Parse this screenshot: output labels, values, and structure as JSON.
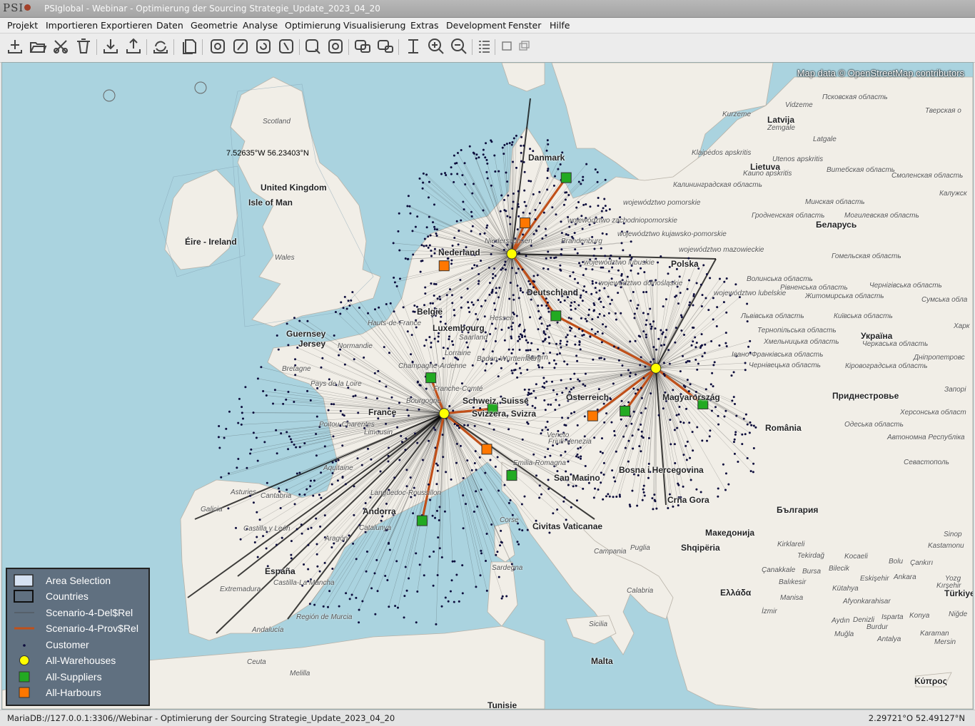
{
  "window": {
    "logo_text": "PSI",
    "title": "PSIglobal - Webinar - Optimierung der Sourcing Strategie_Update_2023_04_20"
  },
  "menu": [
    {
      "label": "Projekt"
    },
    {
      "label": "Importieren"
    },
    {
      "label": "Exportieren"
    },
    {
      "label": "Daten"
    },
    {
      "label": "Geometrie"
    },
    {
      "label": "Analyse"
    },
    {
      "label": "Optimierung"
    },
    {
      "label": "Visualisierung"
    },
    {
      "label": "Extras"
    },
    {
      "label": "Development"
    },
    {
      "label": "Fenster"
    },
    {
      "label": "Hilfe"
    }
  ],
  "toolbar": {
    "icons": [
      "new-icon",
      "open-icon",
      "close-icon",
      "delete-icon",
      "import-icon",
      "export-icon",
      "sync-icon",
      "layers-icon",
      "select-1-icon",
      "select-2-icon",
      "select-3-icon",
      "select-4-icon",
      "zoom-box-icon",
      "refresh-icon",
      "map-view-1-icon",
      "map-view-2-icon",
      "measure-icon",
      "zoom-in-icon",
      "zoom-out-icon",
      "list-icon",
      "window-icon",
      "windows-icon"
    ]
  },
  "map": {
    "attribution": "Map data © OpenStreetMap contributors",
    "cursor_coordinate": "7.52635°W 56.23403°N",
    "places": [
      {
        "name": "Scotland",
        "kind": "region"
      },
      {
        "name": "United Kingdom",
        "kind": "city"
      },
      {
        "name": "Isle of Man",
        "kind": "city"
      },
      {
        "name": "Éire - Ireland",
        "kind": "city"
      },
      {
        "name": "Wales",
        "kind": "region"
      },
      {
        "name": "Guernsey",
        "kind": "city"
      },
      {
        "name": "Jersey",
        "kind": "city"
      },
      {
        "name": "Bretagne",
        "kind": "region"
      },
      {
        "name": "Pays de la Loire",
        "kind": "region"
      },
      {
        "name": "France",
        "kind": "city"
      },
      {
        "name": "Poitou-Charentes",
        "kind": "region"
      },
      {
        "name": "Aquitaine",
        "kind": "region"
      },
      {
        "name": "Asturies",
        "kind": "region"
      },
      {
        "name": "Cantabria",
        "kind": "region"
      },
      {
        "name": "Galicia",
        "kind": "region"
      },
      {
        "name": "Castilla y León",
        "kind": "region"
      },
      {
        "name": "España",
        "kind": "city"
      },
      {
        "name": "Extremadura",
        "kind": "region"
      },
      {
        "name": "Castilla-La Mancha",
        "kind": "region"
      },
      {
        "name": "Andalucía",
        "kind": "region"
      },
      {
        "name": "Región de Murcia",
        "kind": "region"
      },
      {
        "name": "Ceuta",
        "kind": "region"
      },
      {
        "name": "Melilla",
        "kind": "region"
      },
      {
        "name": "Andorra",
        "kind": "city"
      },
      {
        "name": "Catalunya",
        "kind": "region"
      },
      {
        "name": "Aragón",
        "kind": "region"
      },
      {
        "name": "Bourgogne",
        "kind": "region"
      },
      {
        "name": "Lorraine",
        "kind": "region"
      },
      {
        "name": "Luxembourg",
        "kind": "city"
      },
      {
        "name": "België",
        "kind": "city"
      },
      {
        "name": "Nederland",
        "kind": "city"
      },
      {
        "name": "Danmark",
        "kind": "city"
      },
      {
        "name": "Deutschland",
        "kind": "city"
      },
      {
        "name": "Schweiz, Suisse",
        "kind": "city"
      },
      {
        "name": "Svizzera, Svizra",
        "kind": "city"
      },
      {
        "name": "Österreich",
        "kind": "city"
      },
      {
        "name": "Polska",
        "kind": "city"
      },
      {
        "name": "Magyarország",
        "kind": "city"
      },
      {
        "name": "România",
        "kind": "city"
      },
      {
        "name": "Bosna i Hercegovina",
        "kind": "city"
      },
      {
        "name": "Crna Gora",
        "kind": "city"
      },
      {
        "name": "San Marino",
        "kind": "city"
      },
      {
        "name": "Emilia-Romagna",
        "kind": "region"
      },
      {
        "name": "Corse",
        "kind": "region"
      },
      {
        "name": "Sardegna",
        "kind": "region"
      },
      {
        "name": "Civitas Vaticanae",
        "kind": "city"
      },
      {
        "name": "Campania",
        "kind": "region"
      },
      {
        "name": "Puglia",
        "kind": "region"
      },
      {
        "name": "Calabria",
        "kind": "region"
      },
      {
        "name": "Sicilia",
        "kind": "region"
      },
      {
        "name": "Malta",
        "kind": "city"
      },
      {
        "name": "Tunisie",
        "kind": "city"
      },
      {
        "name": "Shqipëria",
        "kind": "city"
      },
      {
        "name": "Македонија",
        "kind": "city"
      },
      {
        "name": "България",
        "kind": "city"
      },
      {
        "name": "Ελλάδα",
        "kind": "city"
      },
      {
        "name": "Türkiye",
        "kind": "city"
      },
      {
        "name": "Κύπρος",
        "kind": "city"
      },
      {
        "name": "Latvija",
        "kind": "city"
      },
      {
        "name": "Lietuva",
        "kind": "city"
      },
      {
        "name": "Беларусь",
        "kind": "city"
      },
      {
        "name": "Україна",
        "kind": "city"
      },
      {
        "name": "Приднестровье",
        "kind": "city"
      },
      {
        "name": "Kurzeme",
        "kind": "region"
      },
      {
        "name": "Zemgale",
        "kind": "region"
      },
      {
        "name": "Vidzeme",
        "kind": "region"
      },
      {
        "name": "Latgale",
        "kind": "region"
      },
      {
        "name": "Псковская область",
        "kind": "region"
      },
      {
        "name": "Тверская о",
        "kind": "region"
      },
      {
        "name": "Klaipėdos apskritis",
        "kind": "region"
      },
      {
        "name": "Utenos apskritis",
        "kind": "region"
      },
      {
        "name": "Kauno apskritis",
        "kind": "region"
      },
      {
        "name": "Витебская область",
        "kind": "region"
      },
      {
        "name": "Смоленская область",
        "kind": "region"
      },
      {
        "name": "Калининградская область",
        "kind": "region"
      },
      {
        "name": "Минская область",
        "kind": "region"
      },
      {
        "name": "Калужск",
        "kind": "region"
      },
      {
        "name": "Гродненская область",
        "kind": "region"
      },
      {
        "name": "Могилевская область",
        "kind": "region"
      },
      {
        "name": "Гомельская область",
        "kind": "region"
      },
      {
        "name": "województwo pomorskie",
        "kind": "region"
      },
      {
        "name": "województwo zachodniopomorskie",
        "kind": "region"
      },
      {
        "name": "województwo kujawsko-pomorskie",
        "kind": "region"
      },
      {
        "name": "województwo mazowieckie",
        "kind": "region"
      },
      {
        "name": "województwo lubuskie",
        "kind": "region"
      },
      {
        "name": "województwo dolnośląskie",
        "kind": "region"
      },
      {
        "name": "województwo lubelskie",
        "kind": "region"
      },
      {
        "name": "Волинська область",
        "kind": "region"
      },
      {
        "name": "Рівненська область",
        "kind": "region"
      },
      {
        "name": "Житомирська область",
        "kind": "region"
      },
      {
        "name": "Чернігівська область",
        "kind": "region"
      },
      {
        "name": "Сумська обла",
        "kind": "region"
      },
      {
        "name": "Львівська область",
        "kind": "region"
      },
      {
        "name": "Київська область",
        "kind": "region"
      },
      {
        "name": "Тернопільська область",
        "kind": "region"
      },
      {
        "name": "Хмельницька область",
        "kind": "region"
      },
      {
        "name": "Черкаська область",
        "kind": "region"
      },
      {
        "name": "Харк",
        "kind": "region"
      },
      {
        "name": "Івано-Франківська область",
        "kind": "region"
      },
      {
        "name": "Чернівецька область",
        "kind": "region"
      },
      {
        "name": "Кіровоградська область",
        "kind": "region"
      },
      {
        "name": "Дніпропетровс",
        "kind": "region"
      },
      {
        "name": "Запорі",
        "kind": "region"
      },
      {
        "name": "Херсонська област",
        "kind": "region"
      },
      {
        "name": "Одеська область",
        "kind": "region"
      },
      {
        "name": "Автономна Республіка",
        "kind": "region"
      },
      {
        "name": "Севастополь",
        "kind": "region"
      },
      {
        "name": "Kirklareli",
        "kind": "region"
      },
      {
        "name": "Tekirdağ",
        "kind": "region"
      },
      {
        "name": "Kocaeli",
        "kind": "region"
      },
      {
        "name": "Bolu",
        "kind": "region"
      },
      {
        "name": "Çankırı",
        "kind": "region"
      },
      {
        "name": "Kastamonu",
        "kind": "region"
      },
      {
        "name": "Sinop",
        "kind": "region"
      },
      {
        "name": "Çanakkale",
        "kind": "region"
      },
      {
        "name": "Bursa",
        "kind": "region"
      },
      {
        "name": "Bilecik",
        "kind": "region"
      },
      {
        "name": "Eskişehir",
        "kind": "region"
      },
      {
        "name": "Ankara",
        "kind": "region"
      },
      {
        "name": "Yozg",
        "kind": "region"
      },
      {
        "name": "Balıkesir",
        "kind": "region"
      },
      {
        "name": "Kütahya",
        "kind": "region"
      },
      {
        "name": "Kırşehir",
        "kind": "region"
      },
      {
        "name": "Manisa",
        "kind": "region"
      },
      {
        "name": "Afyonkarahisar",
        "kind": "region"
      },
      {
        "name": "İzmir",
        "kind": "region"
      },
      {
        "name": "Aydın",
        "kind": "region"
      },
      {
        "name": "Denizli",
        "kind": "region"
      },
      {
        "name": "Isparta",
        "kind": "region"
      },
      {
        "name": "Konya",
        "kind": "region"
      },
      {
        "name": "Niğde",
        "kind": "region"
      },
      {
        "name": "Burdur",
        "kind": "region"
      },
      {
        "name": "Muğla",
        "kind": "region"
      },
      {
        "name": "Antalya",
        "kind": "region"
      },
      {
        "name": "Karaman",
        "kind": "region"
      },
      {
        "name": "Mersin",
        "kind": "region"
      },
      {
        "name": "Hauts-de-France",
        "kind": "region"
      },
      {
        "name": "Normandie",
        "kind": "region"
      },
      {
        "name": "Champagne-Ardenne",
        "kind": "region"
      },
      {
        "name": "Franche-Comté",
        "kind": "region"
      },
      {
        "name": "Limousin",
        "kind": "region"
      },
      {
        "name": "Languedoc-Roussillon",
        "kind": "region"
      },
      {
        "name": "Niedersachsen",
        "kind": "region"
      },
      {
        "name": "Brandenburg",
        "kind": "region"
      },
      {
        "name": "Baden-Württemberg",
        "kind": "region"
      },
      {
        "name": "Bayern",
        "kind": "region"
      },
      {
        "name": "Friuli-Venezia",
        "kind": "region"
      },
      {
        "name": "Veneto",
        "kind": "region"
      },
      {
        "name": "Saarland",
        "kind": "region"
      },
      {
        "name": "Hessen",
        "kind": "region"
      }
    ]
  },
  "network": {
    "warehouses": [
      {
        "lon": 8.8,
        "lat": 52.4
      },
      {
        "lon": 4.2,
        "lat": 45.7
      },
      {
        "lon": 18.6,
        "lat": 47.6
      }
    ],
    "suppliers": [
      {
        "lon": 12.5,
        "lat": 55.6
      },
      {
        "lon": 3.3,
        "lat": 47.2
      },
      {
        "lon": 7.5,
        "lat": 45.9
      },
      {
        "lon": 11.8,
        "lat": 49.8
      },
      {
        "lon": 8.8,
        "lat": 43.1
      },
      {
        "lon": 2.7,
        "lat": 41.2
      },
      {
        "lon": 16.5,
        "lat": 45.8
      },
      {
        "lon": 21.8,
        "lat": 46.1
      }
    ],
    "harbours": [
      {
        "lon": 9.7,
        "lat": 53.7
      },
      {
        "lon": 4.2,
        "lat": 51.9
      },
      {
        "lon": 14.3,
        "lat": 45.6
      },
      {
        "lon": 7.1,
        "lat": 44.2
      }
    ]
  },
  "legend": {
    "items": [
      {
        "label": "Area Selection",
        "symbol": "area-selection-swatch"
      },
      {
        "label": "Countries",
        "symbol": "countries-swatch"
      },
      {
        "label": "Scenario-4-Del$Rel",
        "symbol": "delivery-relation-line"
      },
      {
        "label": "Scenario-4-Prov$Rel",
        "symbol": "provision-relation-line"
      },
      {
        "label": "Customer",
        "symbol": "customer-dot"
      },
      {
        "label": "All-Warehouses",
        "symbol": "warehouse-circle"
      },
      {
        "label": "All-Suppliers",
        "symbol": "supplier-square"
      },
      {
        "label": "All-Harbours",
        "symbol": "harbour-square"
      }
    ]
  },
  "status": {
    "connection": "MariaDB://127.0.0.1:3306//Webinar - Optimierung der Sourcing Strategie_Update_2023_04_20",
    "coordinate": "2.29721°O 52.49127°N"
  },
  "colors": {
    "sea": "#aad3df",
    "land": "#f2efe9",
    "warehouse": "#ffff00",
    "supplier": "#22aa22",
    "harbour": "#ff7700",
    "provision": "#c0501a",
    "customer": "#0c0c3c"
  }
}
